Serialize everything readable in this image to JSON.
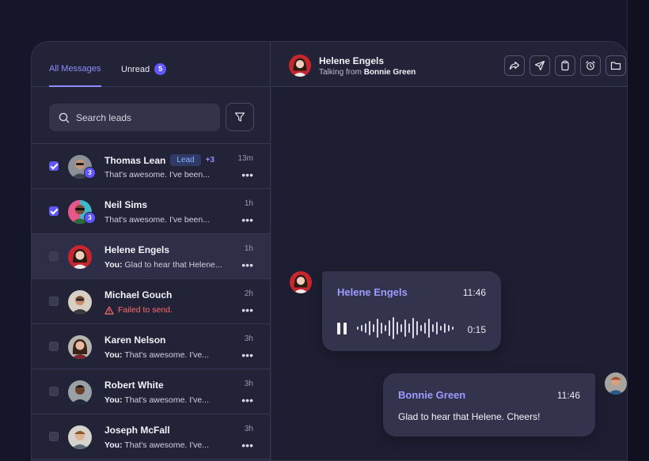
{
  "tabs": {
    "all_messages": "All Messages",
    "unread": "Unread",
    "unread_count": "5"
  },
  "search": {
    "placeholder": "Search leads"
  },
  "conversations": [
    {
      "name": "Thomas Lean",
      "tag": "Lead",
      "extra": "+3",
      "time": "13m",
      "preview_prefix": "",
      "preview": "That's awesome. I've been...",
      "checked": true,
      "badge": "3"
    },
    {
      "name": "Neil Sims",
      "time": "1h",
      "preview_prefix": "",
      "preview": "That's awesome. I've been...",
      "checked": true,
      "badge": "3"
    },
    {
      "name": "Helene Engels",
      "time": "1h",
      "preview_prefix": "You:",
      "preview": " Glad to hear that Helene...",
      "checked": false
    },
    {
      "name": "Michael Gouch",
      "time": "2h",
      "preview_prefix": "",
      "preview": "Failed to send.",
      "checked": false,
      "error": true
    },
    {
      "name": "Karen Nelson",
      "time": "3h",
      "preview_prefix": "You:",
      "preview": " That's awesome. I've...",
      "checked": false
    },
    {
      "name": "Robert White",
      "time": "3h",
      "preview_prefix": "You:",
      "preview": " That's awesome. I've...",
      "checked": false
    },
    {
      "name": "Joseph McFall",
      "time": "3h",
      "preview_prefix": "You:",
      "preview": " That's awesome. I've...",
      "checked": false
    }
  ],
  "chat_header": {
    "name": "Helene Engels",
    "subtitle_prefix": "Talking from ",
    "subtitle_agent": "Bonnie Green",
    "actions": [
      "share-icon",
      "send-icon",
      "clipboard-icon",
      "alarm-icon",
      "folder-icon"
    ]
  },
  "messages": [
    {
      "sender": "Helene Engels",
      "time": "11:46",
      "type": "voice",
      "duration": "0:15"
    },
    {
      "sender": "Bonnie Green",
      "time": "11:46",
      "type": "text",
      "text": "Glad to hear that Helene. Cheers!"
    }
  ],
  "colors": {
    "accent": "#6157ff",
    "accent_text": "#8f8cff",
    "error": "#ff6b6b",
    "panel": "#232338",
    "chat_bg": "#1e1e32",
    "bubble": "#33334e"
  }
}
